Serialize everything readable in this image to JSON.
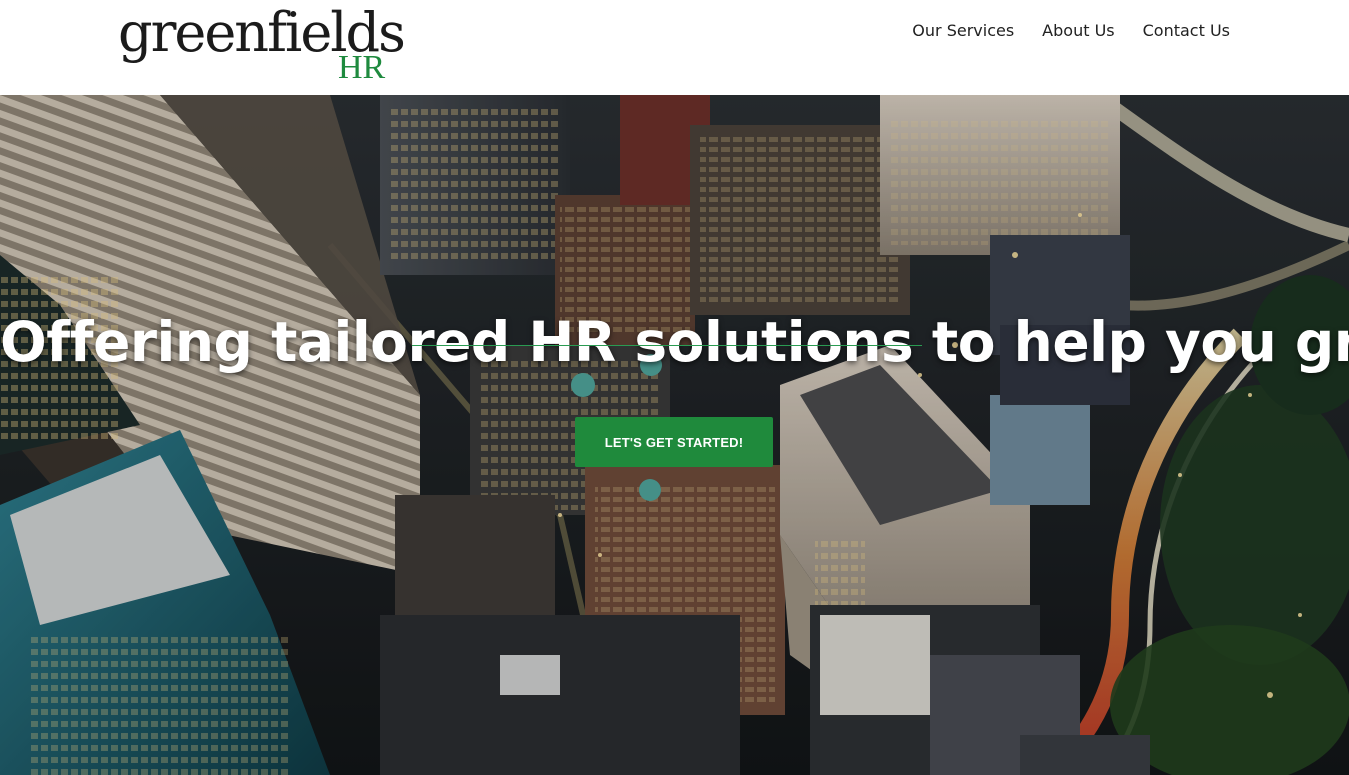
{
  "logo": {
    "word": "greenfields",
    "suffix": "HR"
  },
  "nav": [
    {
      "label": "Our Services"
    },
    {
      "label": "About Us"
    },
    {
      "label": "Contact Us"
    }
  ],
  "hero": {
    "headline": "Offering tailored HR solutions to help you grow",
    "cta_label": "LET'S GET STARTED!"
  },
  "colors": {
    "accent": "#1f8a3c",
    "logo_green": "#1e8a3e",
    "headline": "#ffffff"
  }
}
